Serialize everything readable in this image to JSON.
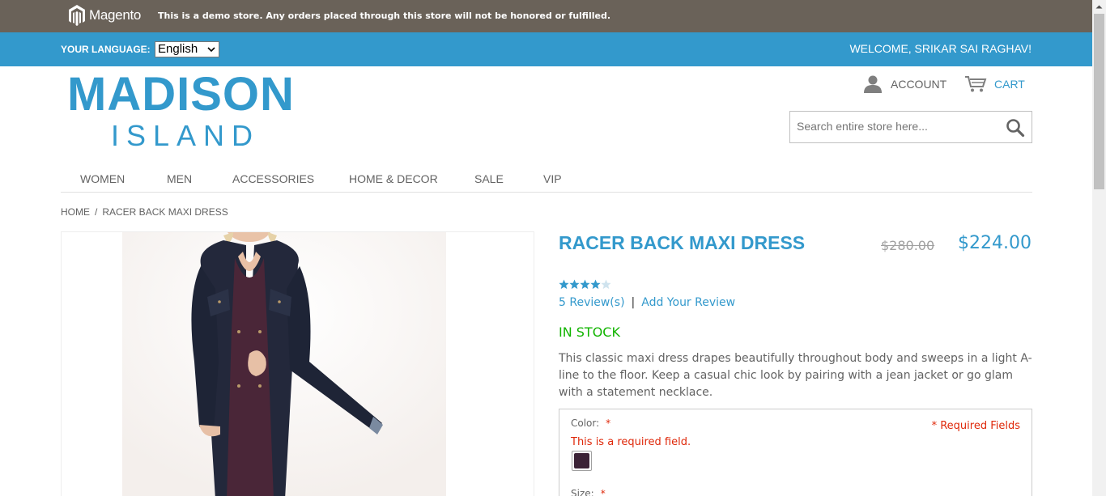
{
  "demo_notice": {
    "brand": "Magento",
    "text": "This is a demo store. Any orders placed through this store will not be honored or fulfilled."
  },
  "language_bar": {
    "label": "YOUR LANGUAGE:",
    "selected_language": "English",
    "welcome": "WELCOME, SRIKAR SAI RAGHAV!"
  },
  "logo": {
    "line1": "MADISON",
    "line2": "ISLAND"
  },
  "header_links": {
    "account": "ACCOUNT",
    "cart": "CART"
  },
  "search": {
    "placeholder": "Search entire store here..."
  },
  "nav": {
    "items": [
      "WOMEN",
      "MEN",
      "ACCESSORIES",
      "HOME & DECOR",
      "SALE",
      "VIP"
    ]
  },
  "breadcrumb": {
    "home": "HOME",
    "separator": "/",
    "current": "RACER BACK MAXI DRESS"
  },
  "product": {
    "name": "RACER BACK MAXI DRESS",
    "old_price": "$280.00",
    "price": "$224.00",
    "rating_stars": 4,
    "rating_max": 5,
    "reviews_link": "5 Review(s)",
    "review_separator": "|",
    "add_review_link": "Add Your Review",
    "stock": "IN STOCK",
    "description": "This classic maxi dress drapes beautifully throughout body and sweeps in a light A-line to the floor. Keep a casual chic look by pairing with a jean jacket or go glam with a statement necklace."
  },
  "options": {
    "color_label": "Color:",
    "required_mark": "*",
    "required_fields_note": "* Required Fields",
    "error": "This is a required field.",
    "swatch_color": "#3b2236",
    "size_label": "Size:"
  },
  "colors": {
    "demo_bar": "#6a6259",
    "accent": "#3399cc",
    "in_stock": "#11b400",
    "error": "#df280a"
  }
}
